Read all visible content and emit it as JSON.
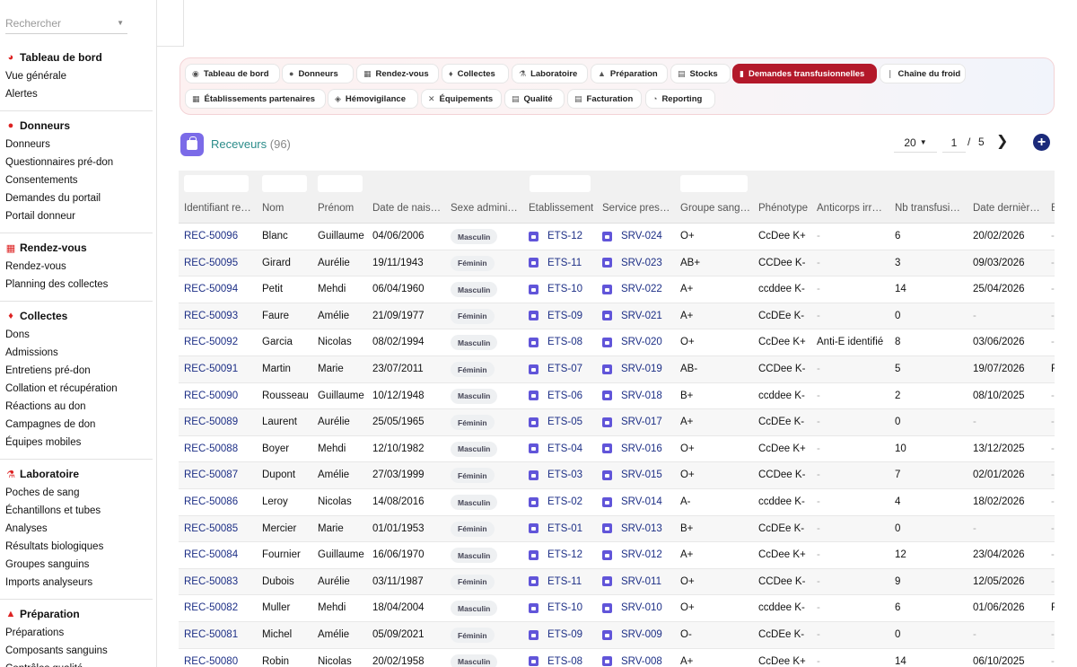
{
  "search": {
    "placeholder": "Rechercher"
  },
  "sidebar": {
    "sections": [
      {
        "title": "Tableau de bord",
        "icon": "dashboard-icon",
        "items": [
          "Vue générale",
          "Alertes"
        ]
      },
      {
        "title": "Donneurs",
        "icon": "user-icon",
        "items": [
          "Donneurs",
          "Questionnaires pré-don",
          "Consentements",
          "Demandes du portail",
          "Portail donneur"
        ]
      },
      {
        "title": "Rendez-vous",
        "icon": "calendar-icon",
        "items": [
          "Rendez-vous",
          "Planning des collectes"
        ]
      },
      {
        "title": "Collectes",
        "icon": "drop-icon",
        "items": [
          "Dons",
          "Admissions",
          "Entretiens pré-don",
          "Collation et récupération",
          "Réactions au don",
          "Campagnes de don",
          "Équipes mobiles"
        ]
      },
      {
        "title": "Laboratoire",
        "icon": "microscope-icon",
        "items": [
          "Poches de sang",
          "Échantillons et tubes",
          "Analyses",
          "Résultats biologiques",
          "Groupes sanguins",
          "Imports analyseurs"
        ]
      },
      {
        "title": "Préparation",
        "icon": "flask-icon",
        "items": [
          "Préparations",
          "Composants sanguins",
          "Contrôles qualité"
        ]
      }
    ]
  },
  "nav": {
    "active": "Demandes transfusionnelles",
    "row1": [
      {
        "label": "Tableau de bord",
        "icon": "dashboard-icon",
        "glyph": "◉"
      },
      {
        "label": "Donneurs",
        "icon": "user-icon",
        "glyph": "●"
      },
      {
        "label": "Rendez-vous",
        "icon": "calendar-icon",
        "glyph": "▦"
      },
      {
        "label": "Collectes",
        "icon": "drop-icon",
        "glyph": "♦"
      },
      {
        "label": "Laboratoire",
        "icon": "microscope-icon",
        "glyph": "⚗"
      },
      {
        "label": "Préparation",
        "icon": "flask-icon",
        "glyph": "▲"
      },
      {
        "label": "Stocks",
        "icon": "warehouse-icon",
        "glyph": "▤"
      },
      {
        "label": "Demandes transfusionnelles",
        "icon": "document-icon",
        "glyph": "▮"
      },
      {
        "label": "Chaîne du froid",
        "icon": "thermometer-icon",
        "glyph": "❘"
      }
    ],
    "row2": [
      {
        "label": "Établissements partenaires",
        "icon": "hospital-icon",
        "glyph": "▦"
      },
      {
        "label": "Hémovigilance",
        "icon": "shield-icon",
        "glyph": "◈"
      },
      {
        "label": "Équipements",
        "icon": "tools-icon",
        "glyph": "✕"
      },
      {
        "label": "Qualité",
        "icon": "clipboard-icon",
        "glyph": "▤"
      },
      {
        "label": "Facturation",
        "icon": "invoice-icon",
        "glyph": "▤"
      },
      {
        "label": "Reporting",
        "icon": "chart-pie-icon",
        "glyph": "◔"
      }
    ]
  },
  "list": {
    "title": "Receveurs",
    "count": "(96)",
    "page_size": "20",
    "page": "1",
    "page_sep": "/",
    "total_pages": "5"
  },
  "table": {
    "columns": [
      "Identifiant re…",
      "Nom",
      "Prénom",
      "Date de nais…",
      "Sexe admini…",
      "Établissement",
      "Service pres…",
      "Groupe sang…",
      "Phénotype",
      "Anticorps irr…",
      "Nb transfusi…",
      "Date dernièr…",
      "E"
    ],
    "rows": [
      {
        "id": "REC-50096",
        "nom": "Blanc",
        "prenom": "Guillaume",
        "dob": "04/06/2006",
        "sexe": "Masculin",
        "etab": "ETS-12",
        "service": "SRV-024",
        "groupe": "O+",
        "phenotype": "CcDee K+",
        "anticorps": "-",
        "nb": "6",
        "date": "20/02/2026",
        "extra": "-"
      },
      {
        "id": "REC-50095",
        "nom": "Girard",
        "prenom": "Aurélie",
        "dob": "19/11/1943",
        "sexe": "Féminin",
        "etab": "ETS-11",
        "service": "SRV-023",
        "groupe": "AB+",
        "phenotype": "CCDee K-",
        "anticorps": "-",
        "nb": "3",
        "date": "09/03/2026",
        "extra": "-"
      },
      {
        "id": "REC-50094",
        "nom": "Petit",
        "prenom": "Mehdi",
        "dob": "06/04/1960",
        "sexe": "Masculin",
        "etab": "ETS-10",
        "service": "SRV-022",
        "groupe": "A+",
        "phenotype": "ccddee K-",
        "anticorps": "-",
        "nb": "14",
        "date": "25/04/2026",
        "extra": "-"
      },
      {
        "id": "REC-50093",
        "nom": "Faure",
        "prenom": "Amélie",
        "dob": "21/09/1977",
        "sexe": "Féminin",
        "etab": "ETS-09",
        "service": "SRV-021",
        "groupe": "A+",
        "phenotype": "CcDEe K-",
        "anticorps": "-",
        "nb": "0",
        "date": "-",
        "extra": "-"
      },
      {
        "id": "REC-50092",
        "nom": "Garcia",
        "prenom": "Nicolas",
        "dob": "08/02/1994",
        "sexe": "Masculin",
        "etab": "ETS-08",
        "service": "SRV-020",
        "groupe": "O+",
        "phenotype": "CcDee K+",
        "anticorps": "Anti-E identifié",
        "nb": "8",
        "date": "03/06/2026",
        "extra": "-"
      },
      {
        "id": "REC-50091",
        "nom": "Martin",
        "prenom": "Marie",
        "dob": "23/07/2011",
        "sexe": "Féminin",
        "etab": "ETS-07",
        "service": "SRV-019",
        "groupe": "AB-",
        "phenotype": "CCDee K-",
        "anticorps": "-",
        "nb": "5",
        "date": "19/07/2026",
        "extra": "F"
      },
      {
        "id": "REC-50090",
        "nom": "Rousseau",
        "prenom": "Guillaume",
        "dob": "10/12/1948",
        "sexe": "Masculin",
        "etab": "ETS-06",
        "service": "SRV-018",
        "groupe": "B+",
        "phenotype": "ccddee K-",
        "anticorps": "-",
        "nb": "2",
        "date": "08/10/2025",
        "extra": "-"
      },
      {
        "id": "REC-50089",
        "nom": "Laurent",
        "prenom": "Aurélie",
        "dob": "25/05/1965",
        "sexe": "Féminin",
        "etab": "ETS-05",
        "service": "SRV-017",
        "groupe": "A+",
        "phenotype": "CcDEe K-",
        "anticorps": "-",
        "nb": "0",
        "date": "-",
        "extra": "-"
      },
      {
        "id": "REC-50088",
        "nom": "Boyer",
        "prenom": "Mehdi",
        "dob": "12/10/1982",
        "sexe": "Masculin",
        "etab": "ETS-04",
        "service": "SRV-016",
        "groupe": "O+",
        "phenotype": "CcDee K+",
        "anticorps": "-",
        "nb": "10",
        "date": "13/12/2025",
        "extra": "-"
      },
      {
        "id": "REC-50087",
        "nom": "Dupont",
        "prenom": "Amélie",
        "dob": "27/03/1999",
        "sexe": "Féminin",
        "etab": "ETS-03",
        "service": "SRV-015",
        "groupe": "O+",
        "phenotype": "CCDee K-",
        "anticorps": "-",
        "nb": "7",
        "date": "02/01/2026",
        "extra": "-"
      },
      {
        "id": "REC-50086",
        "nom": "Leroy",
        "prenom": "Nicolas",
        "dob": "14/08/2016",
        "sexe": "Masculin",
        "etab": "ETS-02",
        "service": "SRV-014",
        "groupe": "A-",
        "phenotype": "ccddee K-",
        "anticorps": "-",
        "nb": "4",
        "date": "18/02/2026",
        "extra": "-"
      },
      {
        "id": "REC-50085",
        "nom": "Mercier",
        "prenom": "Marie",
        "dob": "01/01/1953",
        "sexe": "Féminin",
        "etab": "ETS-01",
        "service": "SRV-013",
        "groupe": "B+",
        "phenotype": "CcDEe K-",
        "anticorps": "-",
        "nb": "0",
        "date": "-",
        "extra": "-"
      },
      {
        "id": "REC-50084",
        "nom": "Fournier",
        "prenom": "Guillaume",
        "dob": "16/06/1970",
        "sexe": "Masculin",
        "etab": "ETS-12",
        "service": "SRV-012",
        "groupe": "A+",
        "phenotype": "CcDee K+",
        "anticorps": "-",
        "nb": "12",
        "date": "23/04/2026",
        "extra": "-"
      },
      {
        "id": "REC-50083",
        "nom": "Dubois",
        "prenom": "Aurélie",
        "dob": "03/11/1987",
        "sexe": "Féminin",
        "etab": "ETS-11",
        "service": "SRV-011",
        "groupe": "O+",
        "phenotype": "CCDee K-",
        "anticorps": "-",
        "nb": "9",
        "date": "12/05/2026",
        "extra": "-"
      },
      {
        "id": "REC-50082",
        "nom": "Muller",
        "prenom": "Mehdi",
        "dob": "18/04/2004",
        "sexe": "Masculin",
        "etab": "ETS-10",
        "service": "SRV-010",
        "groupe": "O+",
        "phenotype": "ccddee K-",
        "anticorps": "-",
        "nb": "6",
        "date": "01/06/2026",
        "extra": "F"
      },
      {
        "id": "REC-50081",
        "nom": "Michel",
        "prenom": "Amélie",
        "dob": "05/09/2021",
        "sexe": "Féminin",
        "etab": "ETS-09",
        "service": "SRV-009",
        "groupe": "O-",
        "phenotype": "CcDEe K-",
        "anticorps": "-",
        "nb": "0",
        "date": "-",
        "extra": "-"
      },
      {
        "id": "REC-50080",
        "nom": "Robin",
        "prenom": "Nicolas",
        "dob": "20/02/1958",
        "sexe": "Masculin",
        "etab": "ETS-08",
        "service": "SRV-008",
        "groupe": "A+",
        "phenotype": "CcDee K+",
        "anticorps": "-",
        "nb": "14",
        "date": "06/10/2025",
        "extra": "-"
      }
    ]
  }
}
